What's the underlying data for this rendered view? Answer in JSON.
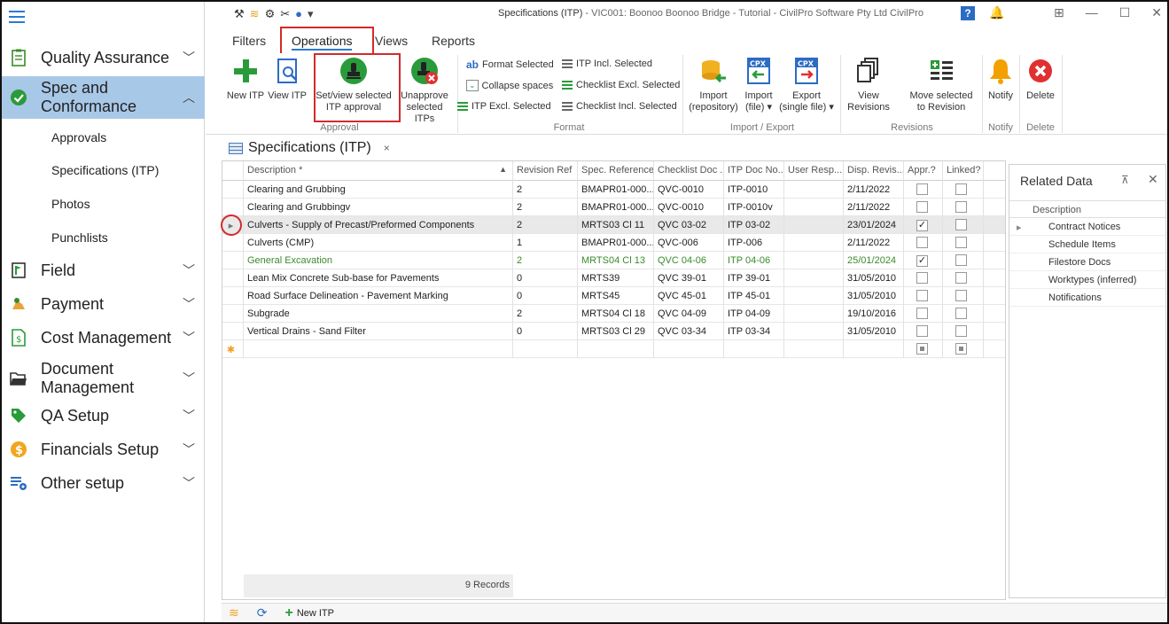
{
  "titlebar": {
    "title_main": "Specifications (ITP)",
    "title_rest": " - VIC001: Boonoo Boonoo Bridge - Tutorial - CivilPro Software Pty Ltd CivilPro"
  },
  "sidebar": {
    "items": [
      {
        "label": "Quality Assurance",
        "icon": "clipboard-icon"
      },
      {
        "label": "Spec and Conformance",
        "icon": "check-circle-icon"
      },
      {
        "label": "Field",
        "icon": "flag-icon"
      },
      {
        "label": "Payment",
        "icon": "payment-icon"
      },
      {
        "label": "Cost Management",
        "icon": "cost-doc-icon"
      },
      {
        "label": "Document Management",
        "icon": "folder-icon"
      },
      {
        "label": "QA Setup",
        "icon": "tag-icon"
      },
      {
        "label": "Financials Setup",
        "icon": "dollar-icon"
      },
      {
        "label": "Other setup",
        "icon": "settings-table-icon"
      }
    ],
    "subitems": [
      "Approvals",
      "Specifications (ITP)",
      "Photos",
      "Punchlists"
    ]
  },
  "ribbon": {
    "tabs": [
      "Filters",
      "Operations",
      "Views",
      "Reports"
    ],
    "buttons": {
      "new_itp": "New ITP",
      "view_itp": "View ITP",
      "set_view_1": "Set/view selected",
      "set_view_2": "ITP approval",
      "unapprove_1": "Unapprove",
      "unapprove_2": "selected ITPs",
      "format_selected": "Format Selected",
      "collapse_spaces": "Collapse spaces",
      "itp_excl_selected": "ITP Excl. Selected",
      "itp_incl_selected": "ITP Incl. Selected",
      "checklist_excl_selected": "Checklist Excl. Selected",
      "checklist_incl_selected": "Checklist Incl. Selected",
      "import_repo_1": "Import",
      "import_repo_2": "(repository)",
      "import_file_1": "Import",
      "import_file_2": "(file)",
      "export_1": "Export",
      "export_2": "(single file)",
      "view_revisions_1": "View",
      "view_revisions_2": "Revisions",
      "move_selected_1": "Move selected",
      "move_selected_2": "to Revision",
      "notify": "Notify",
      "delete": "Delete"
    },
    "groups": {
      "approval": "Approval",
      "format": "Format",
      "import_export": "Import / Export",
      "revisions": "Revisions",
      "notify": "Notify",
      "delete": "Delete"
    }
  },
  "doc_tab": {
    "label": "Specifications (ITP)",
    "close": "×"
  },
  "grid": {
    "columns": [
      "Description *",
      "Revision Ref",
      "Spec. Reference",
      "Checklist Doc ...",
      "ITP Doc No...",
      "User Resp...",
      "Disp. Revis...",
      "Appr.?",
      "Linked?"
    ],
    "rows": [
      {
        "desc": "Clearing and Grubbing",
        "rev": "2",
        "spec": "BMAPR01-000...",
        "checklist": "QVC-0010",
        "itp": "ITP-0010",
        "user": "",
        "disp": "2/11/2022",
        "appr": false,
        "linked": false,
        "selected": false,
        "green": false
      },
      {
        "desc": "Clearing and Grubbingv",
        "rev": "2",
        "spec": "BMAPR01-000...",
        "checklist": "QVC-0010",
        "itp": "ITP-0010v",
        "user": "",
        "disp": "2/11/2022",
        "appr": false,
        "linked": false,
        "selected": false,
        "green": false
      },
      {
        "desc": "Culverts - Supply of Precast/Preformed Components",
        "rev": "2",
        "spec": "MRTS03 Cl 11",
        "checklist": "QVC 03-02",
        "itp": "ITP 03-02",
        "user": "",
        "disp": "23/01/2024",
        "appr": true,
        "linked": false,
        "selected": true,
        "green": false
      },
      {
        "desc": "Culverts (CMP)",
        "rev": "1",
        "spec": "BMAPR01-000...",
        "checklist": "QVC-006",
        "itp": "ITP-006",
        "user": "",
        "disp": "2/11/2022",
        "appr": false,
        "linked": false,
        "selected": false,
        "green": false
      },
      {
        "desc": "General Excavation",
        "rev": "2",
        "spec": "MRTS04 Cl 13",
        "checklist": "QVC 04-06",
        "itp": "ITP 04-06",
        "user": "",
        "disp": "25/01/2024",
        "appr": true,
        "linked": false,
        "selected": false,
        "green": true
      },
      {
        "desc": "Lean Mix Concrete Sub-base for Pavements",
        "rev": "0",
        "spec": "MRTS39",
        "checklist": "QVC 39-01",
        "itp": "ITP 39-01",
        "user": "",
        "disp": "31/05/2010",
        "appr": false,
        "linked": false,
        "selected": false,
        "green": false
      },
      {
        "desc": "Road Surface Delineation - Pavement Marking",
        "rev": "0",
        "spec": "MRTS45",
        "checklist": "QVC 45-01",
        "itp": "ITP 45-01",
        "user": "",
        "disp": "31/05/2010",
        "appr": false,
        "linked": false,
        "selected": false,
        "green": false
      },
      {
        "desc": "Subgrade",
        "rev": "2",
        "spec": "MRTS04 Cl 18",
        "checklist": "QVC 04-09",
        "itp": "ITP 04-09",
        "user": "",
        "disp": "19/10/2016",
        "appr": false,
        "linked": false,
        "selected": false,
        "green": false
      },
      {
        "desc": "Vertical Drains - Sand Filter",
        "rev": "0",
        "spec": "MRTS03 Cl 29",
        "checklist": "QVC 03-34",
        "itp": "ITP 03-34",
        "user": "",
        "disp": "31/05/2010",
        "appr": false,
        "linked": false,
        "selected": false,
        "green": false
      }
    ],
    "new_row_marker": "✱",
    "footer": "9 Records"
  },
  "related": {
    "title": "Related Data",
    "pin": "⊼",
    "close": "✕",
    "column": "Description",
    "items": [
      "Contract Notices",
      "Schedule Items",
      "Filestore Docs",
      "Worktypes (inferred)",
      "Notifications"
    ]
  },
  "bottombar": {
    "new_itp": "New ITP"
  },
  "colors": {
    "accent": "#2b7bd1",
    "active_nav": "#a8c8e8",
    "highlight": "#d42a2a",
    "green_row": "#3a8b2a"
  }
}
